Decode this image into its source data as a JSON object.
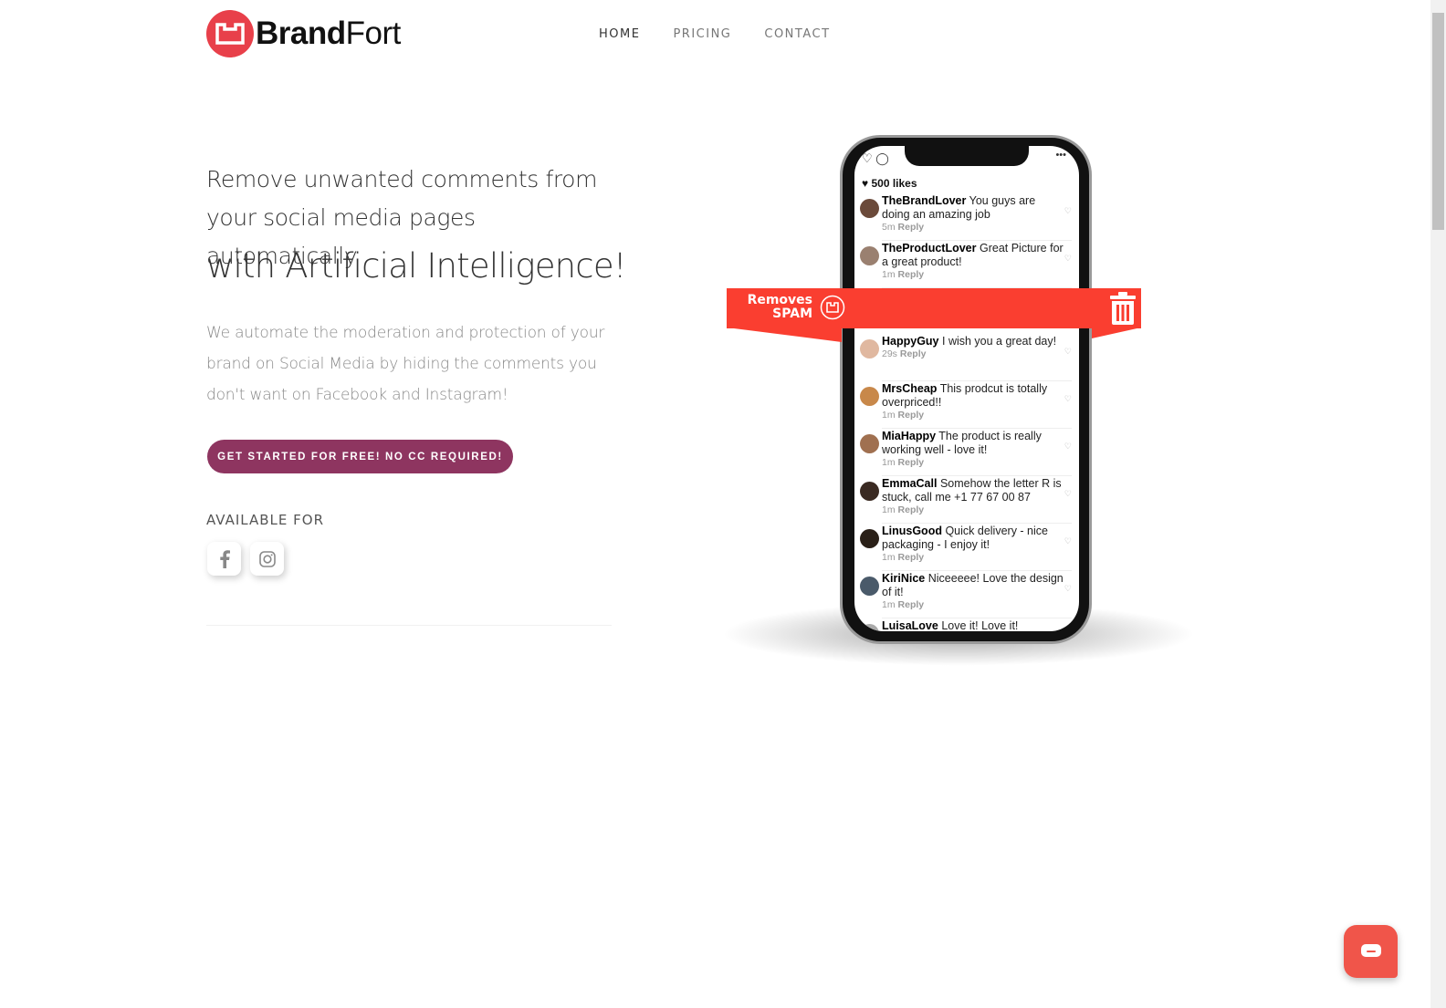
{
  "brand": {
    "bold": "Brand",
    "light": "Fort",
    "color": "#e8404a"
  },
  "nav": [
    {
      "label": "HOME",
      "active": true
    },
    {
      "label": "PRICING"
    },
    {
      "label": "CONTACT"
    }
  ],
  "hero": {
    "headline": "Remove unwanted comments from your social media pages automatically",
    "headline2": "with Artificial Intelligence!",
    "lead": "We automate the moderation and protection of your brand on Social Media by hiding the comments you don't want on Facebook and Instagram!",
    "cta": "GET STARTED FOR FREE! NO CC REQUIRED!",
    "cta_color": "#8e3560",
    "available": "AVAILABLE FOR",
    "platforms": [
      "facebook-icon",
      "instagram-icon"
    ]
  },
  "phone": {
    "likes": "500 likes",
    "comments": [
      {
        "user": "TheBrandLover",
        "text": "You guys are doing an amazing job",
        "time": "5m",
        "reply": "Reply",
        "avatar": "#6b4a3a"
      },
      {
        "user": "TheProductLover",
        "text": "Great Picture for a great product!",
        "time": "1m",
        "reply": "Reply",
        "avatar": "#9a8070"
      },
      {
        "user": "HappyGuy",
        "text": "I wish you a great day!",
        "time": "29s",
        "reply": "Reply",
        "avatar": "#e0b8a0"
      },
      {
        "user": "MrsCheap",
        "text": "This prodcut is totally overpriced!!",
        "time": "1m",
        "reply": "Reply",
        "avatar": "#c8884a"
      },
      {
        "user": "MiaHappy",
        "text": "The product is really working well - love it!",
        "time": "1m",
        "reply": "Reply",
        "avatar": "#a07050"
      },
      {
        "user": "EmmaCall",
        "text": "Somehow the letter R is stuck, call me +1 77 67 00 87",
        "time": "1m",
        "reply": "Reply",
        "avatar": "#3a2a22"
      },
      {
        "user": "LinusGood",
        "text": "Quick delivery - nice packaging - I enjoy it!",
        "time": "1m",
        "reply": "Reply",
        "avatar": "#2a2018"
      },
      {
        "user": "KiriNice",
        "text": "Niceeeee! Love the design of it!",
        "time": "1m",
        "reply": "Reply",
        "avatar": "#4a5a6a"
      },
      {
        "user": "LuisaLove",
        "text": "Love it! Love it!",
        "time": "",
        "reply": "",
        "avatar": "#aaaaaa"
      }
    ],
    "banner_line1": "Removes",
    "banner_line2": "SPAM",
    "banner_color": "#fa3e30"
  }
}
